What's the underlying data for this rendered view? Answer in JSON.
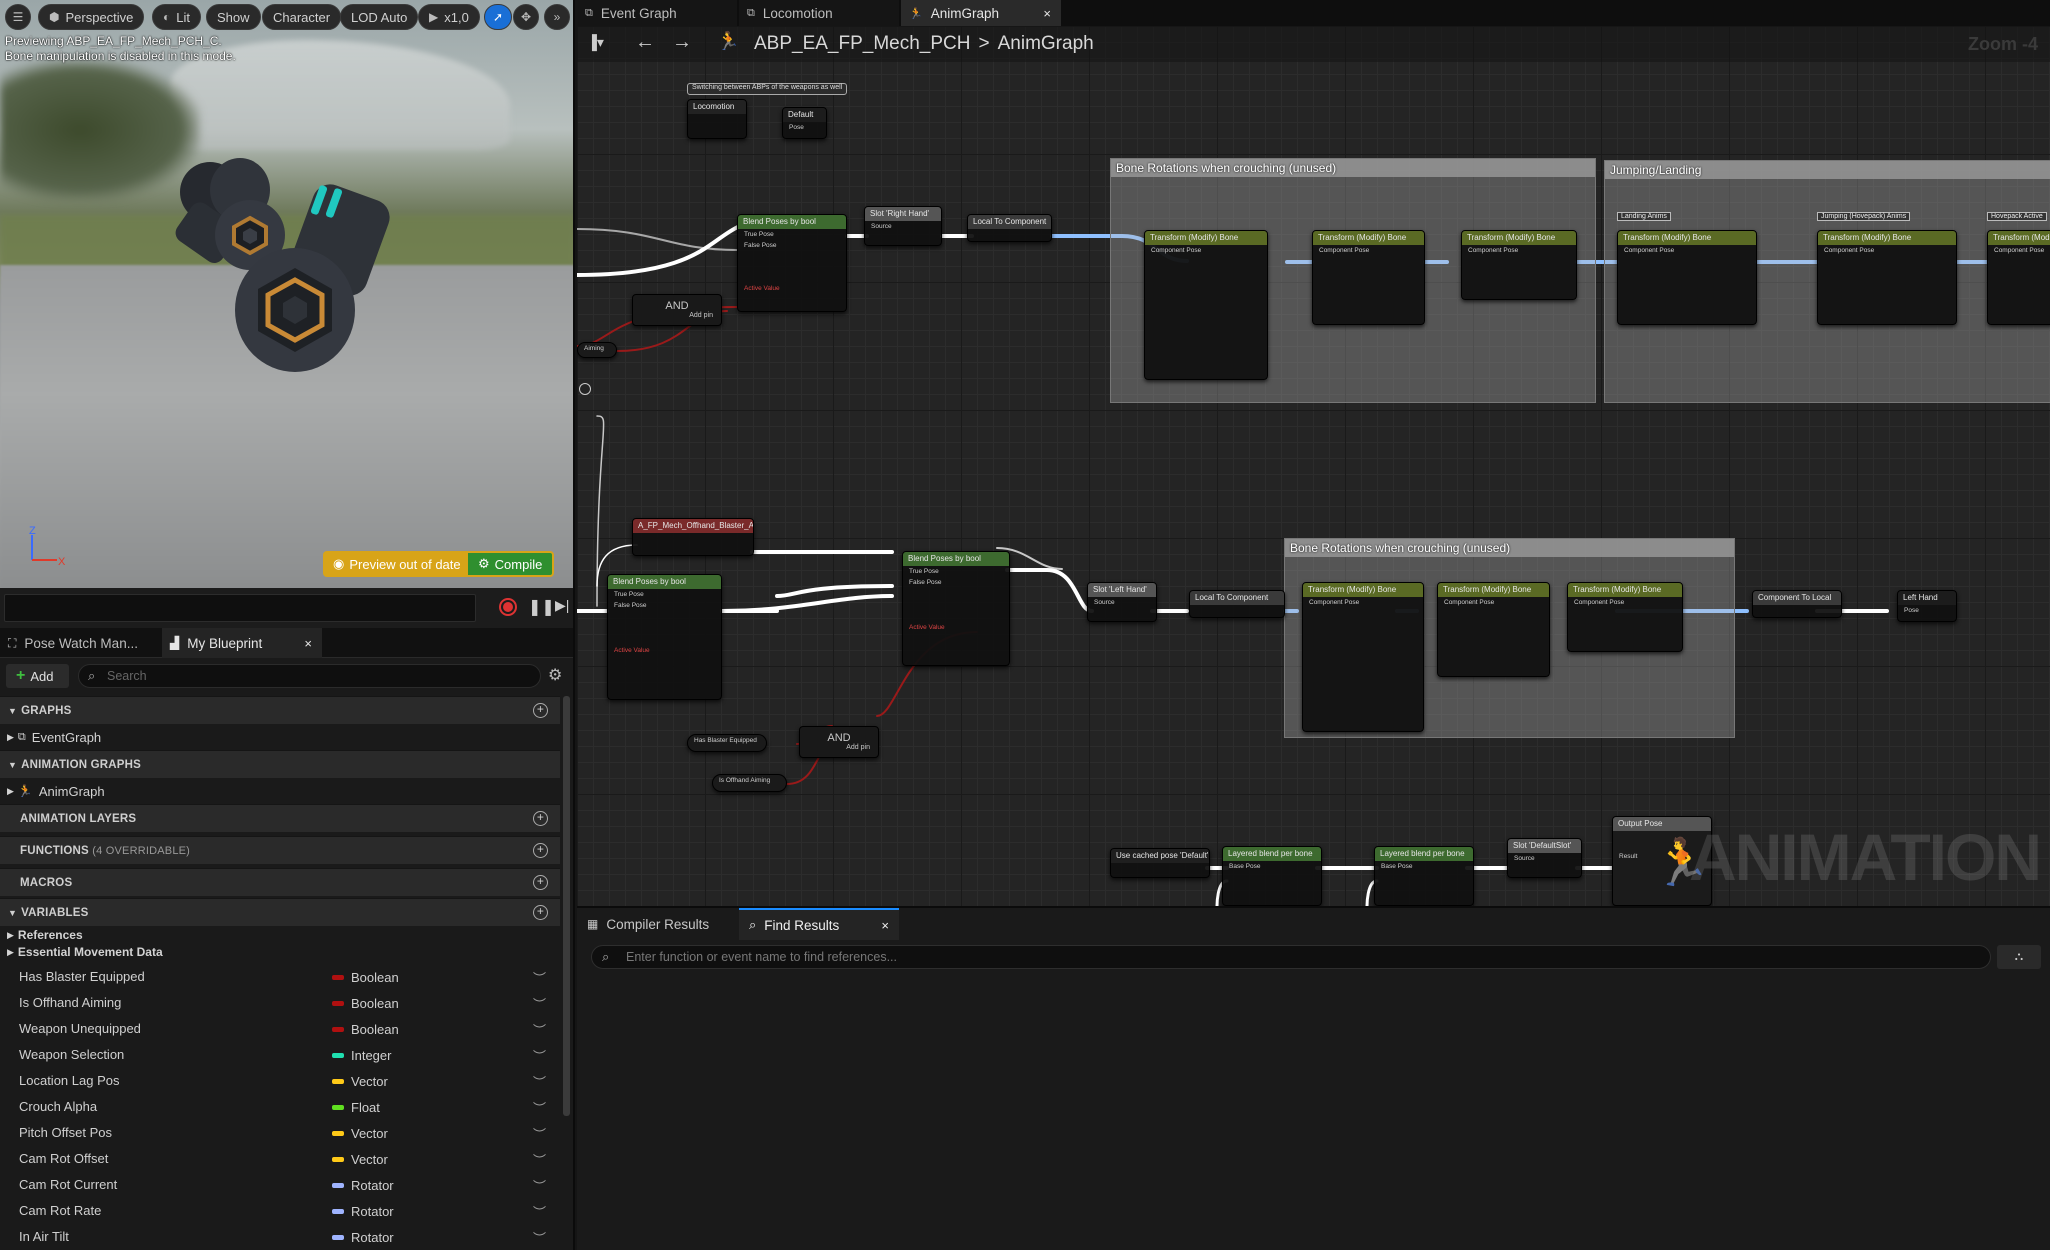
{
  "viewport": {
    "toolbar": {
      "perspective": "Perspective",
      "lit": "Lit",
      "show": "Show",
      "character": "Character",
      "lod": "LOD Auto",
      "speed": "x1,0"
    },
    "message_line1": "Previewing ABP_EA_FP_Mech_PCH_C.",
    "message_line2": "Bone manipulation is disabled in this mode.",
    "preview_out_of_date": "Preview out of date",
    "compile": "Compile",
    "axis_z": "Z",
    "axis_x": "X"
  },
  "left_panel": {
    "tabs": {
      "pose_watch": "Pose Watch Man...",
      "my_blueprint": "My Blueprint"
    },
    "add_label": "Add",
    "search_placeholder": "Search",
    "sections": {
      "graphs": "GRAPHS",
      "animation_graphs": "ANIMATION GRAPHS",
      "animation_layers": "ANIMATION LAYERS",
      "functions": "FUNCTIONS",
      "functions_sub": "(4 OVERRIDABLE)",
      "macros": "MACROS",
      "variables": "VARIABLES"
    },
    "graph_items": {
      "event_graph": "EventGraph",
      "anim_graph": "AnimGraph"
    },
    "categories": {
      "references": "References",
      "essential": "Essential Movement Data"
    },
    "variables": [
      {
        "name": "Has Blaster Equipped",
        "type": "Boolean",
        "color": "#b01010"
      },
      {
        "name": "Is Offhand Aiming",
        "type": "Boolean",
        "color": "#b01010"
      },
      {
        "name": "Weapon Unequipped",
        "type": "Boolean",
        "color": "#b01010"
      },
      {
        "name": "Weapon Selection",
        "type": "Integer",
        "color": "#1fe0b0"
      },
      {
        "name": "Location Lag Pos",
        "type": "Vector",
        "color": "#ffca18"
      },
      {
        "name": "Crouch Alpha",
        "type": "Float",
        "color": "#60e020"
      },
      {
        "name": "Pitch Offset Pos",
        "type": "Vector",
        "color": "#ffca18"
      },
      {
        "name": "Cam Rot Offset",
        "type": "Vector",
        "color": "#ffca18"
      },
      {
        "name": "Cam Rot Current",
        "type": "Rotator",
        "color": "#9fb4ff"
      },
      {
        "name": "Cam Rot Rate",
        "type": "Rotator",
        "color": "#9fb4ff"
      },
      {
        "name": "In Air Tilt",
        "type": "Rotator",
        "color": "#9fb4ff"
      }
    ]
  },
  "editor_tabs": {
    "event_graph": "Event Graph",
    "locomotion": "Locomotion",
    "anim_graph": "AnimGraph"
  },
  "graph": {
    "breadcrumb_asset": "ABP_EA_FP_Mech_PCH",
    "breadcrumb_sep": ">",
    "breadcrumb_graph": "AnimGraph",
    "zoom": "Zoom -4",
    "watermark": "ANIMATION",
    "comments": {
      "c1": "Bone Rotations when crouching (unused)",
      "c2": "Jumping/Landing",
      "c3": "Bone Rotations when crouching (unused)",
      "note": "Switching between ABPs of the weapons as well"
    },
    "nodes": {
      "locomotion": "Locomotion",
      "default": "Default",
      "pose": "Pose",
      "blend_bool": "Blend Poses by bool",
      "slot_right": "Slot 'Right Hand'",
      "local_to_comp": "Local To Component",
      "transform_bone": "Transform (Modify) Bone",
      "and": "AND",
      "add_pin": "Add pin",
      "offhand_aim": "A_FP_Mech_Offhand_Blaster_Aim",
      "slot_left": "Slot 'Left Hand'",
      "comp_to_local": "Component To Local",
      "left_hand": "Left Hand",
      "cached_pose": "Use cached pose 'Default'",
      "layered": "Layered blend per bone",
      "slot_default": "Slot 'DefaultSlot'",
      "output_pose": "Output Pose",
      "has_blaster": "Has Blaster Equipped",
      "is_offhand": "Is Offhand Aiming",
      "aiming": "Aiming",
      "landing": "Landing Anims",
      "jumping": "Jumping (Hovepack) Anims",
      "hovepack": "Hovepack Active",
      "true_pose": "True Pose",
      "false_pose": "False Pose",
      "active_value": "Active Value",
      "component_pose": "Component Pose",
      "source": "Source",
      "base_pose": "Base Pose",
      "result": "Result"
    }
  },
  "bottom_panel": {
    "tabs": {
      "compiler": "Compiler Results",
      "find": "Find Results"
    },
    "find_placeholder": "Enter function or event name to find references..."
  }
}
